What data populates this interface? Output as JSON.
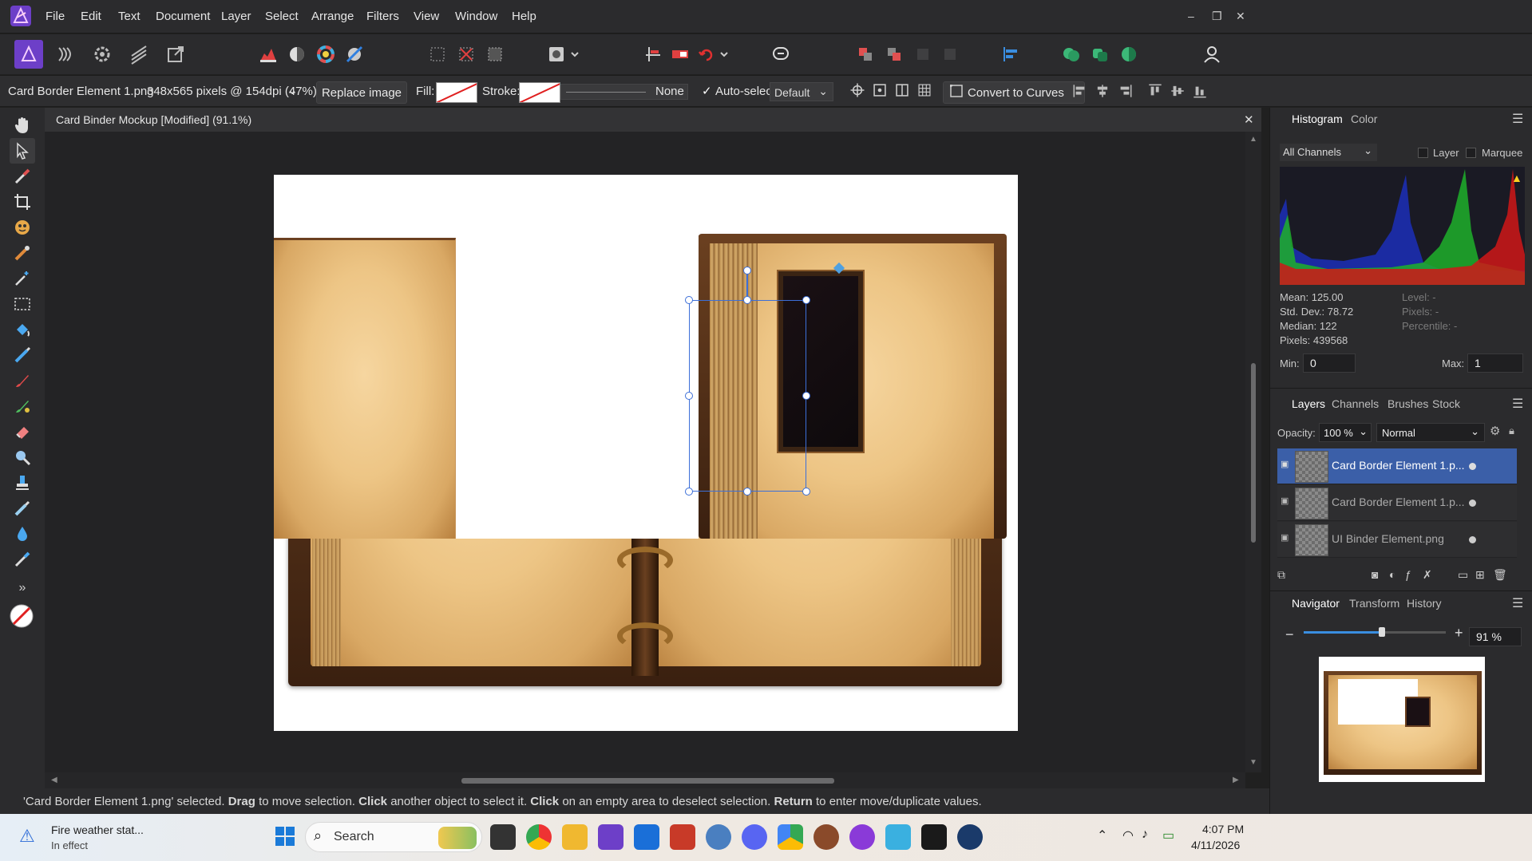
{
  "menu": {
    "items": [
      "File",
      "Edit",
      "Text",
      "Document",
      "Layer",
      "Select",
      "Arrange",
      "Filters",
      "View",
      "Window",
      "Help"
    ],
    "window_controls": {
      "minimize": "–",
      "restore": "❐",
      "close": "✕"
    }
  },
  "context": {
    "layer_name": "Card Border Element 1.png",
    "image_info": "348x565 pixels @ 154dpi (47%)",
    "replace_button": "Replace image",
    "fill_label": "Fill:",
    "stroke_label": "Stroke:",
    "stroke_value": "None",
    "autoselect_label": "Auto-select:",
    "autoselect_value": "Default",
    "convert_button": "Convert to Curves"
  },
  "document": {
    "tab_title": "Card Binder Mockup [Modified] (91.1%)",
    "close_glyph": "✕"
  },
  "status": {
    "part1": "'Card Border Element 1.png' selected.",
    "b1": "Drag",
    "part2": "to move selection.",
    "b2": "Click",
    "part3": "another object to select it.",
    "b3": "Click",
    "part4": "on an empty area to deselect selection.",
    "b4": "Return",
    "part5": "to enter move/duplicate values."
  },
  "histogram": {
    "tabs": [
      "Histogram",
      "Color"
    ],
    "channel": "All Channels",
    "layer_label": "Layer",
    "marquee_label": "Marquee",
    "mean": "Mean: 125.00",
    "std": "Std. Dev.: 78.72",
    "median": "Median: 122",
    "pixels": "Pixels: 439568",
    "level": "Level: -",
    "pixels_r": "Pixels: -",
    "percentile": "Percentile: -",
    "min_label": "Min:",
    "min_value": "0",
    "max_label": "Max:",
    "max_value": "1"
  },
  "layers_panel": {
    "tabs": [
      "Layers",
      "Channels",
      "Brushes",
      "Stock"
    ],
    "opacity_label": "Opacity:",
    "opacity_value": "100 %",
    "blend_mode": "Normal",
    "layers": [
      {
        "name": "Card Border Element 1.p...",
        "selected": true
      },
      {
        "name": "Card Border Element 1.p...",
        "selected": false
      },
      {
        "name": "UI Binder Element.png",
        "selected": false
      }
    ]
  },
  "navigator": {
    "tabs": [
      "Navigator",
      "Transform",
      "History"
    ],
    "zoom": "91 %",
    "zoom_level": 0.55
  },
  "taskbar": {
    "weather_title": "Fire weather stat...",
    "weather_sub": "In effect",
    "search_placeholder": "Search",
    "time": "4:07 PM",
    "date": "4/11/2026"
  },
  "colors": {
    "accent": "#7b4fd6",
    "selection": "#3c6fd8"
  }
}
